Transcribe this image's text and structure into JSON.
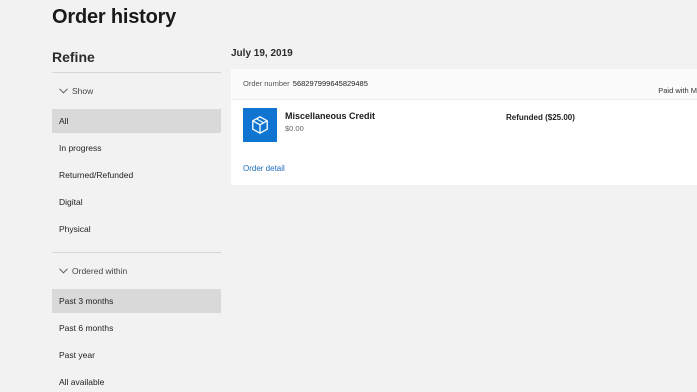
{
  "page": {
    "title": "Order history"
  },
  "sidebar": {
    "refine_label": "Refine",
    "show_group": {
      "label": "Show",
      "items": [
        {
          "label": "All",
          "selected": true
        },
        {
          "label": "In progress",
          "selected": false
        },
        {
          "label": "Returned/Refunded",
          "selected": false
        },
        {
          "label": "Digital",
          "selected": false
        },
        {
          "label": "Physical",
          "selected": false
        }
      ]
    },
    "ordered_within_group": {
      "label": "Ordered within",
      "items": [
        {
          "label": "Past 3 months",
          "selected": true
        },
        {
          "label": "Past 6 months",
          "selected": false
        },
        {
          "label": "Past year",
          "selected": false
        },
        {
          "label": "All available",
          "selected": false
        }
      ]
    }
  },
  "orders": [
    {
      "date": "July 19, 2019",
      "order_number_label": "Order number",
      "order_number": "5682979996458294​85",
      "paid_with": "Paid with M",
      "item": {
        "icon": "package-icon",
        "name": "Miscellaneous Credit",
        "price": "$0.00",
        "status": "Refunded ($25.00)"
      },
      "detail_link": "Order detail"
    }
  ],
  "colors": {
    "background": "#f2f2f2",
    "selected_filter": "#d9d9d9",
    "card": "#ffffff",
    "product_tile": "#1075d0",
    "link": "#1b6cb8"
  }
}
